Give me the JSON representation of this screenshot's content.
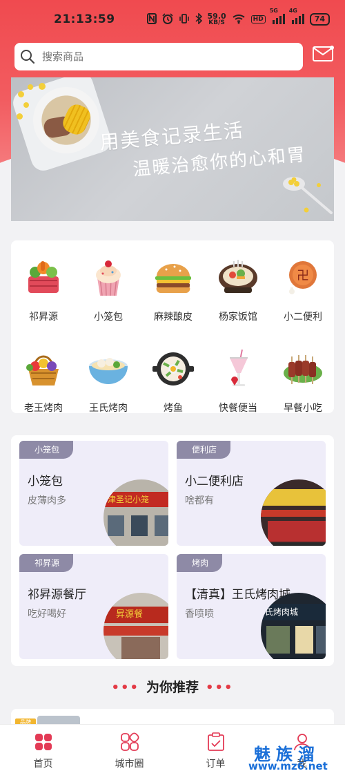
{
  "status_bar": {
    "time": "21:13:59",
    "net_speed_value": "59.0",
    "net_speed_unit": "KB/S",
    "hd_label": "HD",
    "sig1_label": "5G",
    "sig2_label": "4G",
    "battery": "74"
  },
  "search": {
    "placeholder": "搜索商品"
  },
  "banner": {
    "line1": "用美食记录生活",
    "line2": "温暖治愈你的心和胃"
  },
  "categories": [
    {
      "label": "祁昇源",
      "icon": "veggie-basket-icon"
    },
    {
      "label": "小笼包",
      "icon": "cupcake-icon"
    },
    {
      "label": "麻辣酿皮",
      "icon": "burger-icon"
    },
    {
      "label": "杨家饭馆",
      "icon": "hotpot-icon"
    },
    {
      "label": "小二便利",
      "icon": "cookie-icon"
    },
    {
      "label": "老王烤肉",
      "icon": "fruit-basket-icon"
    },
    {
      "label": "王氏烤肉",
      "icon": "noodle-bowl-icon"
    },
    {
      "label": "烤鱼",
      "icon": "bibimbap-icon"
    },
    {
      "label": "快餐便当",
      "icon": "milkshake-icon"
    },
    {
      "label": "早餐小吃",
      "icon": "skewers-icon"
    }
  ],
  "shops": [
    {
      "tag": "小笼包",
      "name": "小笼包",
      "desc": "皮薄肉多",
      "photo_sign": "津圣记小笼"
    },
    {
      "tag": "便利店",
      "name": "小二便利店",
      "desc": "啥都有",
      "photo_sign": ""
    },
    {
      "tag": "祁昇源",
      "name": "祁昇源餐厅",
      "desc": "吃好喝好",
      "photo_sign": "昇源餐"
    },
    {
      "tag": "烤肉",
      "name": "【清真】王氏烤肉城",
      "desc": "香喷喷",
      "photo_sign": "氏烤肉城"
    }
  ],
  "recommend": {
    "title": "为你推荐",
    "dots": "•••",
    "peek_badge": "品牌"
  },
  "tabbar": [
    {
      "label": "首页",
      "active": true
    },
    {
      "label": "城市圈",
      "active": false
    },
    {
      "label": "订单",
      "active": false
    },
    {
      "label": "我",
      "active": false
    }
  ],
  "watermark": {
    "brand": "魅族溜",
    "url": "www.mz6.net"
  },
  "colors": {
    "accent": "#f04a4f",
    "tag_bg": "#8e8aa6",
    "card_bg": "#efedf9",
    "tab_active": "#e33a55"
  }
}
